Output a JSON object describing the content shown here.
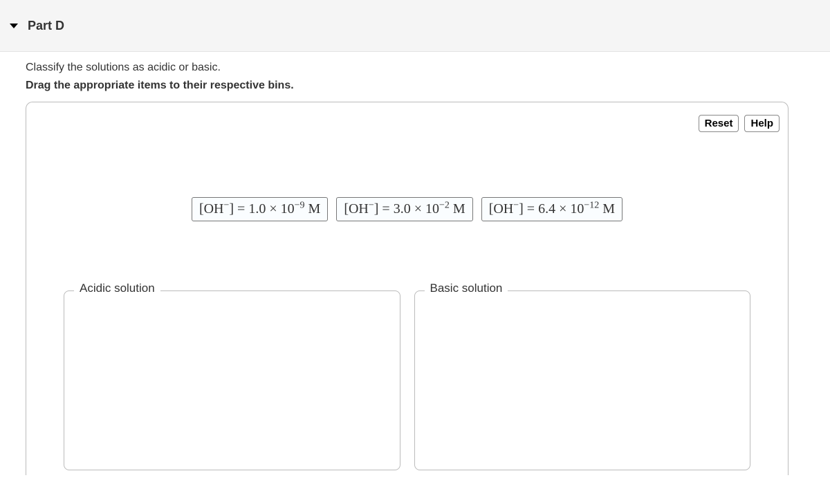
{
  "header": {
    "title": "Part D"
  },
  "instructions": {
    "line1": "Classify the solutions as acidic or basic.",
    "line2": "Drag the appropriate items to their respective bins."
  },
  "panel": {
    "buttons": {
      "reset": "Reset",
      "help": "Help"
    },
    "items": [
      {
        "base": "[OH",
        "sup1": "−",
        "mid": "] = 1.0 × 10",
        "sup2": "−9",
        "tail": " M"
      },
      {
        "base": "[OH",
        "sup1": "−",
        "mid": "] = 3.0 × 10",
        "sup2": "−2",
        "tail": " M"
      },
      {
        "base": "[OH",
        "sup1": "−",
        "mid": "] = 6.4 × 10",
        "sup2": "−12",
        "tail": " M"
      }
    ],
    "bins": {
      "acidic": "Acidic solution",
      "basic": "Basic solution"
    }
  }
}
